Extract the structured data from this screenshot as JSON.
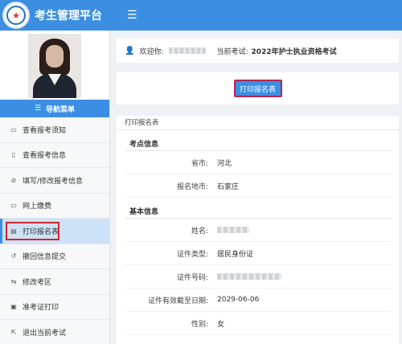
{
  "header": {
    "title": "考生管理平台",
    "menu_icon": "hamburger-icon"
  },
  "sidebar": {
    "nav_header": "导航菜单",
    "items": [
      {
        "label": "查看报考须知",
        "icon": "document-icon"
      },
      {
        "label": "查看报考信息",
        "icon": "file-icon"
      },
      {
        "label": "填写/修改报考信息",
        "icon": "check-circle-icon"
      },
      {
        "label": "网上缴费",
        "icon": "payment-icon"
      },
      {
        "label": "打印报名表",
        "icon": "print-icon",
        "active": true
      },
      {
        "label": "撤回信息提交",
        "icon": "undo-icon"
      },
      {
        "label": "修改考区",
        "icon": "swap-icon"
      },
      {
        "label": "准考证打印",
        "icon": "ticket-icon"
      },
      {
        "label": "退出当前考试",
        "icon": "logout-icon"
      }
    ]
  },
  "welcome": {
    "greeting": "欢迎你:",
    "exam_label": "当前考试:",
    "exam_name": "2022年护士执业资格考试"
  },
  "actions": {
    "print_button": "打印报名表"
  },
  "form": {
    "title": "打印报名表",
    "exam_point_section": "考点信息",
    "exam_point_rows": [
      {
        "label": "省市:",
        "value": "河北"
      },
      {
        "label": "报名地市:",
        "value": "石家庄"
      }
    ],
    "basic_section": "基本信息",
    "basic_rows": [
      {
        "label": "姓名:",
        "value": ""
      },
      {
        "label": "证件类型:",
        "value": "居民身份证"
      },
      {
        "label": "证件号码:",
        "value": ""
      },
      {
        "label": "证件有效截至日期:",
        "value": "2029-06-06"
      },
      {
        "label": "性别:",
        "value": "女"
      }
    ]
  }
}
